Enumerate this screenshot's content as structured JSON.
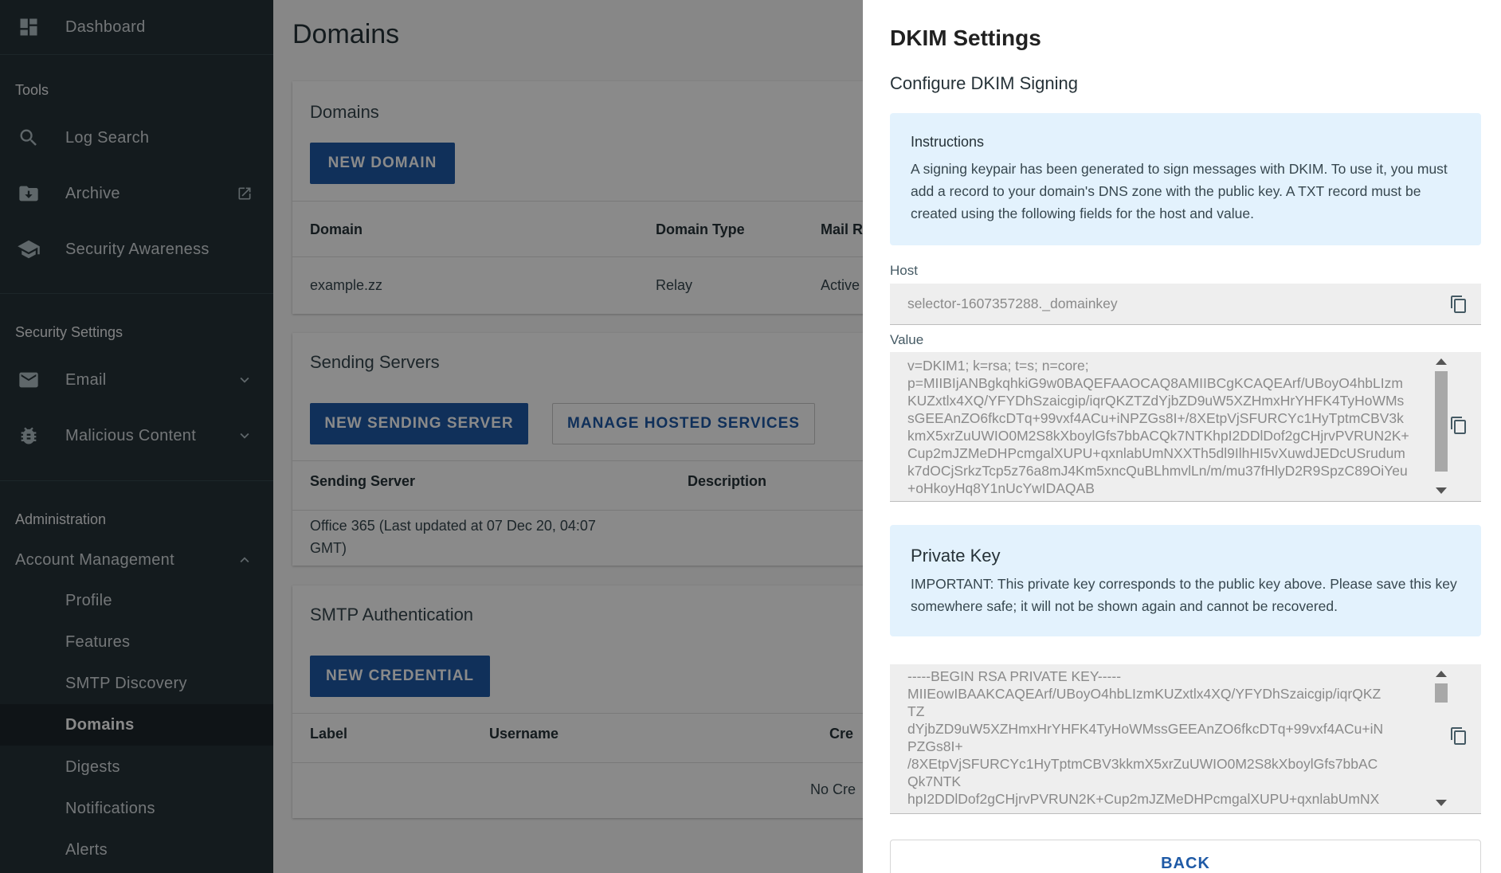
{
  "sidebar": {
    "dashboard": "Dashboard",
    "tools_section": "Tools",
    "log_search": "Log Search",
    "archive": "Archive",
    "security_awareness": "Security Awareness",
    "security_settings_section": "Security Settings",
    "email": "Email",
    "malicious_content": "Malicious Content",
    "administration_section": "Administration",
    "account_management": "Account Management",
    "sub_items": [
      "Profile",
      "Features",
      "SMTP Discovery",
      "Domains",
      "Digests",
      "Notifications",
      "Alerts"
    ],
    "active_item": "Domains"
  },
  "main": {
    "title": "Domains",
    "domains_card": {
      "title": "Domains",
      "new_button": "NEW DOMAIN",
      "headers": [
        "Domain",
        "Domain Type",
        "Mail R"
      ],
      "row": [
        "example.zz",
        "Relay",
        "Active"
      ]
    },
    "sending_card": {
      "title": "Sending Servers",
      "new_button": "NEW SENDING SERVER",
      "manage_button": "MANAGE HOSTED SERVICES",
      "headers": [
        "Sending Server",
        "Description"
      ],
      "row_line1": "Office 365 (Last updated at 07 Dec 20, 04:07",
      "row_line2": "GMT)"
    },
    "smtp_card": {
      "title": "SMTP Authentication",
      "new_button": "NEW CREDENTIAL",
      "headers": [
        "Label",
        "Username",
        "Cre"
      ],
      "empty": "No Cre"
    }
  },
  "panel": {
    "title": "DKIM Settings",
    "subtitle": "Configure DKIM Signing",
    "instructions_title": "Instructions",
    "instructions_text": "A signing keypair has been generated to sign messages with DKIM. To use it, you must add a record to your domain's DNS zone with the public key. A TXT record must be created using the following fields for the host and value.",
    "host_label": "Host",
    "host_value": "selector-1607357288._domainkey",
    "value_label": "Value",
    "value_text": "v=DKIM1; k=rsa; t=s; n=core;\np=MIIBIjANBgkqhkiG9w0BAQEFAAOCAQ8AMIIBCgKCAQEArf/UBoyO4hbLIzmKUZxtlx4XQ/YFYDhSzaicgip/iqrQKZTZdYjbZD9uW5XZHmxHrYHFK4TyHoWMssGEEAnZO6fkcDTq+99vxf4ACu+iNPZGs8I+/8XEtpVjSFURCYc1HyTptmCBV3kkmX5xrZuUWIO0M2S8kXboylGfs7bbACQk7NTKhpI2DDlDof2gCHjrvPVRUN2K+Cup2mJZMeDHPcmgalXUPU+qxnlabUmNXXTh5dl9IlhHI5vXuwdJEDcUSrudumk7dOCjSrkzTcp5z76a8mJ4Km5xncQuBLhmvlLn/m/mu37fHlyD2R9SpzC89OiYeu+oHkoyHq8Y1nUcYwIDAQAB",
    "private_title": "Private Key",
    "private_text": "IMPORTANT: This private key corresponds to the public key above. Please save this key somewhere safe; it will not be shown again and cannot be recovered.",
    "private_key_text": "-----BEGIN RSA PRIVATE KEY-----\nMIIEowIBAAKCAQEArf/UBoyO4hbLIzmKUZxtlx4XQ/YFYDhSzaicgip/iqrQKZ\nTZ\ndYjbZD9uW5XZHmxHrYHFK4TyHoWMssGEEAnZO6fkcDTq+99vxf4ACu+iN\nPZGs8I+\n/8XEtpVjSFURCYc1HyTptmCBV3kkmX5xrZuUWIO0M2S8kXboylGfs7bbAC\nQk7NTK\nhpI2DDlDof2gCHjrvPVRUN2K+Cup2mJZMeDHPcmgalXUPU+qxnlabUmNX",
    "back_button": "BACK"
  }
}
